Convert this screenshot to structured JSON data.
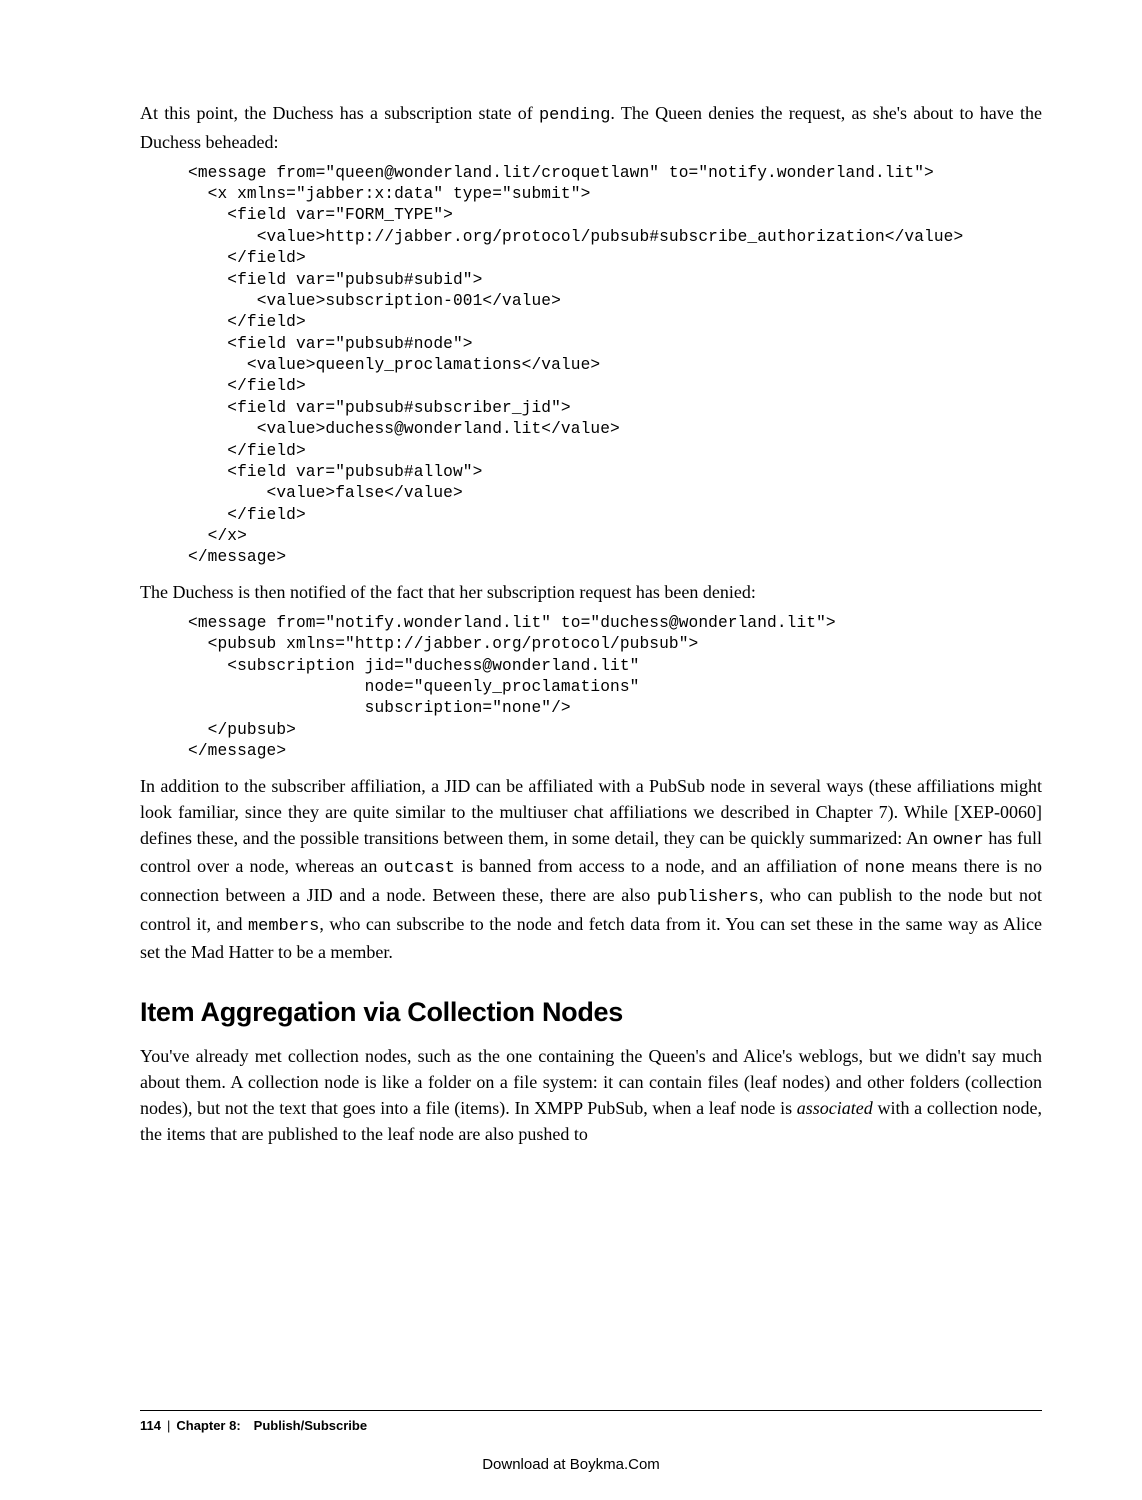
{
  "para1_a": "At this point, the Duchess has a subscription state of ",
  "para1_mono": "pending",
  "para1_b": ". The Queen denies the request, as she's about to have the Duchess beheaded:",
  "code1": "<message from=\"queen@wonderland.lit/croquetlawn\" to=\"notify.wonderland.lit\">\n  <x xmlns=\"jabber:x:data\" type=\"submit\">\n    <field var=\"FORM_TYPE\">\n       <value>http://jabber.org/protocol/pubsub#subscribe_authorization</value>\n    </field>\n    <field var=\"pubsub#subid\">\n       <value>subscription-001</value>\n    </field>\n    <field var=\"pubsub#node\">\n      <value>queenly_proclamations</value>\n    </field>\n    <field var=\"pubsub#subscriber_jid\">\n       <value>duchess@wonderland.lit</value>\n    </field>\n    <field var=\"pubsub#allow\">\n        <value>false</value>\n    </field>\n  </x>\n</message>",
  "para2": "The Duchess is then notified of the fact that her subscription request has been denied:",
  "code2": "<message from=\"notify.wonderland.lit\" to=\"duchess@wonderland.lit\">\n  <pubsub xmlns=\"http://jabber.org/protocol/pubsub\">\n    <subscription jid=\"duchess@wonderland.lit\"\n                  node=\"queenly_proclamations\"\n                  subscription=\"none\"/>\n  </pubsub>\n</message>",
  "para3_a": "In addition to the subscriber affiliation, a JID can be affiliated with a PubSub node in several ways (these affiliations might look familiar, since they are quite similar to the multiuser chat affiliations we described in Chapter 7). While [XEP-0060] defines these, and the possible transitions between them, in some detail, they can be quickly summarized: An ",
  "para3_m1": "owner",
  "para3_b": " has full control over a node, whereas an ",
  "para3_m2": "outcast",
  "para3_c": " is banned from access to a node, and an affiliation of ",
  "para3_m3": "none",
  "para3_d": " means there is no connection between a JID and a node. Between these, there are also ",
  "para3_m4": "publishers",
  "para3_e": ", who can publish to the node but not control it, and ",
  "para3_m5": "members",
  "para3_f": ", who can subscribe to the node and fetch data from it. You can set these in the same way as Alice set the Mad Hatter to be a member.",
  "heading": "Item Aggregation via Collection Nodes",
  "para4_a": "You've already met collection nodes, such as the one containing the Queen's and Alice's weblogs, but we didn't say much about them. A collection node is like a folder on a file system: it can contain files (leaf nodes) and other folders (collection nodes), but not the text that goes into a file (items). In XMPP PubSub, when a leaf node is ",
  "para4_em": "associated",
  "para4_b": " with a collection node, the items that are published to the leaf node are also pushed to",
  "footer": {
    "page": "114",
    "sep": "|",
    "chapter": "Chapter 8: Publish/Subscribe"
  },
  "download": "Download at Boykma.Com"
}
